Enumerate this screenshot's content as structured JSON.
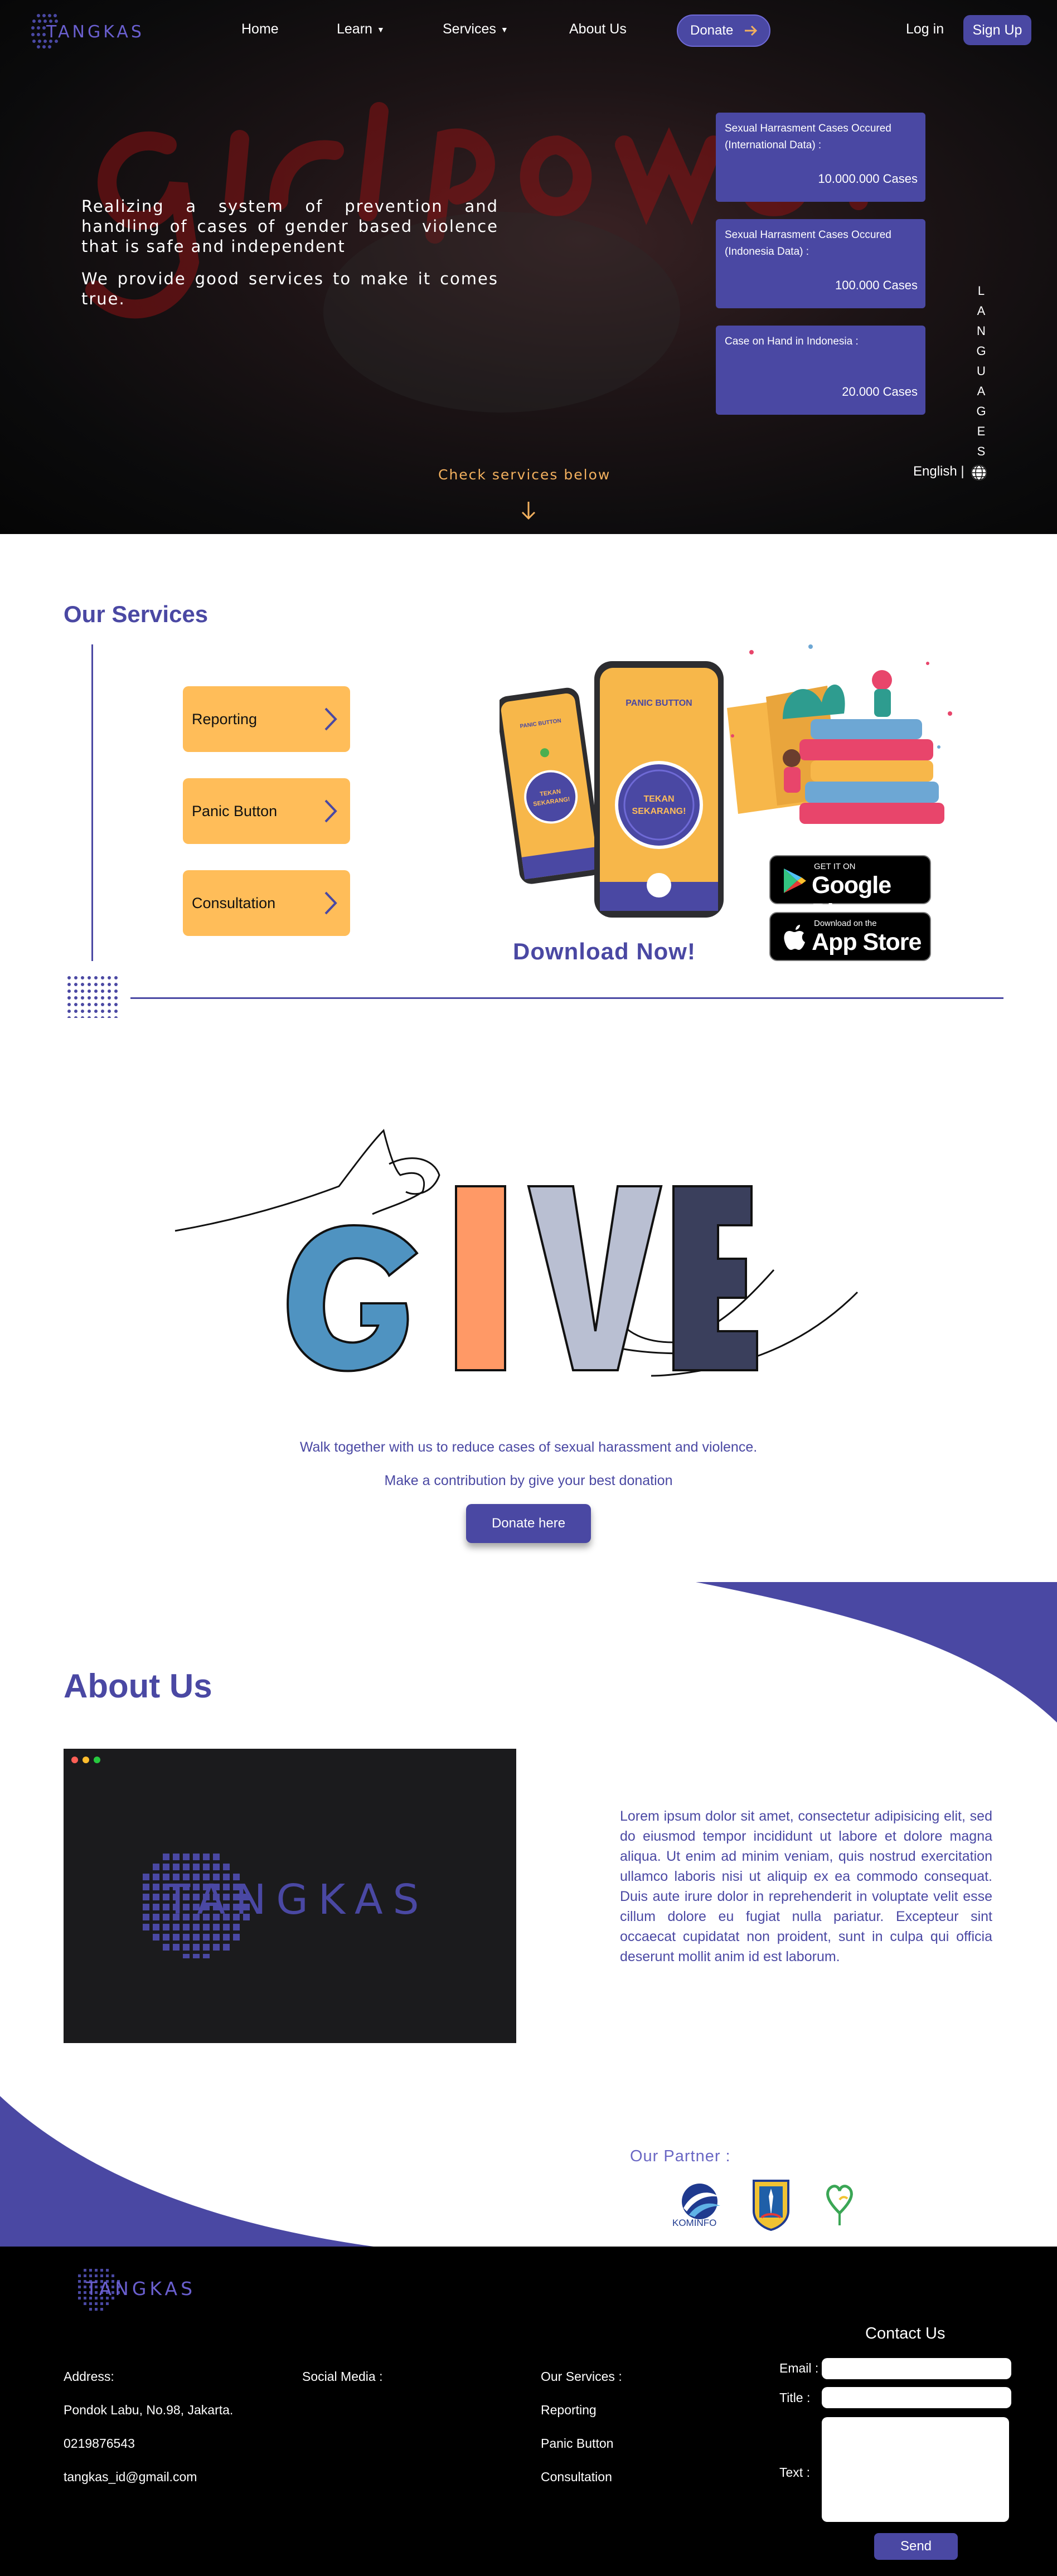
{
  "nav": {
    "logo_text": "TANGKAS",
    "home": "Home",
    "learn": "Learn",
    "services": "Services",
    "about": "About Us",
    "donate": "Donate",
    "login": "Log in",
    "signup": "Sign Up"
  },
  "hero": {
    "background_word": "girl power",
    "paragraph1": "Realizing a system of prevention and handling of cases of gender based violence that is safe and independent",
    "paragraph2": "We provide good services to make it comes true.",
    "check_services": "Check services below",
    "languages_vertical": [
      "L",
      "A",
      "N",
      "G",
      "U",
      "A",
      "G",
      "E",
      "S"
    ],
    "language_current": "English |",
    "stats": [
      {
        "label": "Sexual Harrasment Cases Occured (International Data) :",
        "value": "10.000.000 Cases"
      },
      {
        "label": "Sexual Harrasment Cases Occured (Indonesia Data) :",
        "value": "100.000 Cases"
      },
      {
        "label": "Case on Hand in Indonesia :",
        "value": "20.000 Cases"
      }
    ]
  },
  "services": {
    "title": "Our Services",
    "items": [
      {
        "label": "Reporting"
      },
      {
        "label": "Panic Button"
      },
      {
        "label": "Consultation"
      }
    ],
    "phone_text": {
      "panic_button": "PANIC BUTTON",
      "tekan": "TEKAN",
      "sekarang": "SEKARANG!"
    },
    "download_now": "Download Now!",
    "google_play": {
      "small": "GET IT ON",
      "big": "Google Play"
    },
    "app_store": {
      "small": "Download on the",
      "big": "App Store"
    }
  },
  "give": {
    "art_word": "GIVE",
    "line1": "Walk together with us to reduce cases of sexual harassment and violence.",
    "line2": "Make a contribution by give your best donation",
    "button": "Donate here"
  },
  "about": {
    "title": "About Us",
    "window_logo": "TANGKAS",
    "text": "Lorem ipsum dolor sit amet, consectetur adipisicing elit, sed do eiusmod tempor incididunt ut labore et dolore magna aliqua. Ut enim ad minim veniam, quis nostrud exercitation ullamco laboris nisi ut aliquip ex ea commodo consequat. Duis aute irure dolor in reprehenderit in voluptate velit esse cillum dolore eu fugiat nulla pariatur. Excepteur sint occaecat cupidatat non proident, sunt in culpa qui officia deserunt mollit anim id est laborum."
  },
  "partners": {
    "title": "Our Partner :",
    "kominfo": "KOMINFO"
  },
  "footer": {
    "logo_text": "TANGKAS",
    "address_col": [
      "Address:",
      "Pondok Labu, No.98, Jakarta.",
      "0219876543",
      "tangkas_id@gmail.com"
    ],
    "social_title": "Social Media :",
    "services_col": [
      "Our Services :",
      "Reporting",
      "Panic Button",
      "Consultation"
    ],
    "contact_title": "Contact Us",
    "email_label": "Email :",
    "title_label": "Title  :",
    "text_label": "Text   :",
    "send": "Send"
  },
  "colors": {
    "brand": "#4a48a3",
    "accent": "#ffbd59",
    "hero_orange": "#f2b05e"
  }
}
